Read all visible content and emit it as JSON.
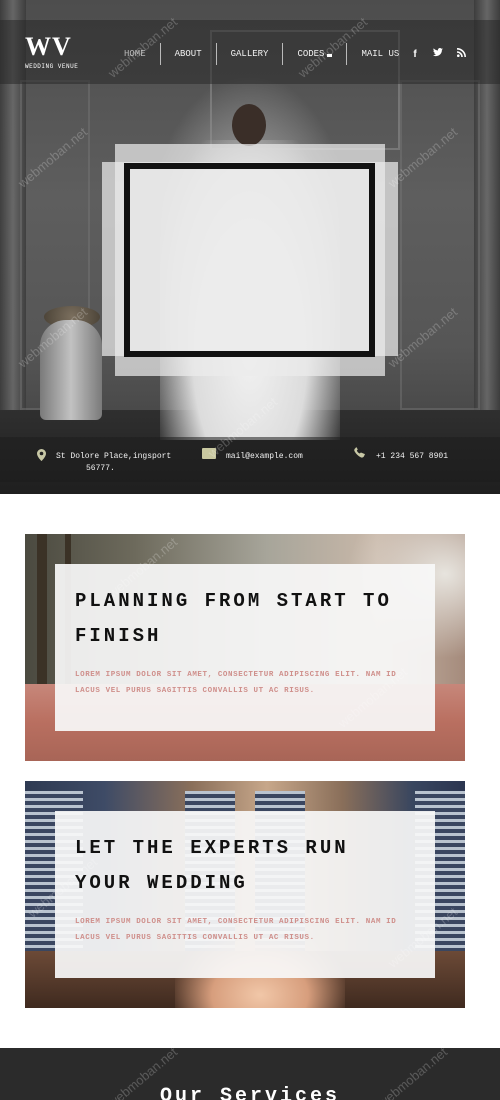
{
  "header": {
    "logo_mark": "WV",
    "logo_sub": "WEDDING VENUE",
    "nav": [
      "HOME",
      "ABOUT",
      "GALLERY",
      "CODES",
      "MAIL US"
    ],
    "active_nav": "HOME",
    "social_icons": [
      "facebook-icon",
      "twitter-icon",
      "rss-icon"
    ]
  },
  "contact": {
    "address_line1": "St Dolore Place,ingsport",
    "address_line2": "56777.",
    "email": "mail@example.com",
    "phone": "+1 234 567 8901"
  },
  "cards": [
    {
      "title": "PLANNING FROM START TO FINISH",
      "text": "LOREM IPSUM DOLOR SIT AMET, CONSECTETUR ADIPISCING ELIT. NAM ID LACUS VEL PURUS SAGITTIS CONVALLIS UT AC RISUS."
    },
    {
      "title": "LET THE EXPERTS RUN YOUR WEDDING",
      "text": "LOREM IPSUM DOLOR SIT AMET, CONSECTETUR ADIPISCING ELIT. NAM ID LACUS VEL PURUS SAGITTIS CONVALLIS UT AC RISUS."
    }
  ],
  "services": {
    "title": "Our Services"
  },
  "watermark": "webmoban.net",
  "colors": {
    "card_text": "#cf8f8b",
    "frame_border": "#111111",
    "services_bg": "#2b2b2b"
  }
}
